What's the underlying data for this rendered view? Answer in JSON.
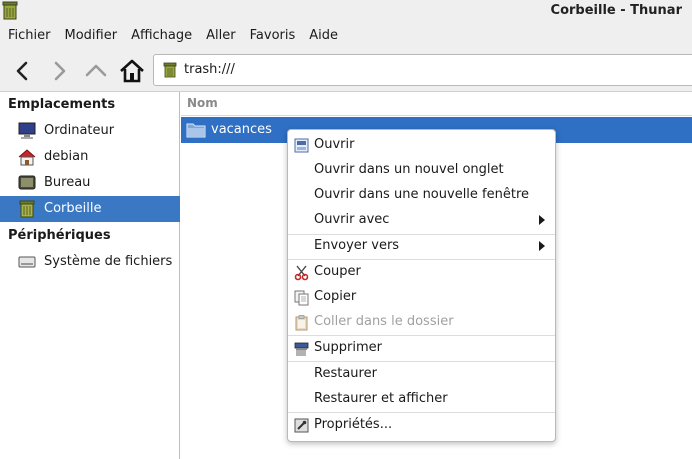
{
  "window": {
    "title": "Corbeille - Thunar"
  },
  "menubar": {
    "items": [
      "Fichier",
      "Modifier",
      "Affichage",
      "Aller",
      "Favoris",
      "Aide"
    ]
  },
  "toolbar": {
    "back_icon": "arrow-left-icon",
    "forward_icon": "arrow-right-icon",
    "up_icon": "arrow-up-icon",
    "home_icon": "home-icon",
    "location": "trash:///"
  },
  "sidebar": {
    "sections": [
      {
        "header": "Emplacements",
        "items": [
          {
            "label": "Ordinateur",
            "icon": "computer-icon"
          },
          {
            "label": "debian",
            "icon": "home-folder-icon"
          },
          {
            "label": "Bureau",
            "icon": "desktop-icon"
          },
          {
            "label": "Corbeille",
            "icon": "trash-icon",
            "selected": true
          }
        ]
      },
      {
        "header": "Périphériques",
        "items": [
          {
            "label": "Système de fichiers",
            "icon": "drive-icon"
          }
        ]
      }
    ]
  },
  "main": {
    "column_header": "Nom",
    "files": [
      {
        "name": "vacances",
        "icon": "folder-icon",
        "selected": true
      }
    ]
  },
  "context_menu": {
    "items": [
      {
        "label": "Ouvrir",
        "icon": "open-icon"
      },
      {
        "label": "Ouvrir dans un nouvel onglet"
      },
      {
        "label": "Ouvrir dans une nouvelle fenêtre"
      },
      {
        "label": "Ouvrir avec",
        "submenu": true
      },
      {
        "label": "Envoyer vers",
        "submenu": true
      },
      {
        "label": "Couper",
        "icon": "scissors-icon"
      },
      {
        "label": "Copier",
        "icon": "copy-icon"
      },
      {
        "label": "Coller dans le dossier",
        "icon": "paste-icon",
        "disabled": true
      },
      {
        "label": "Supprimer",
        "icon": "shredder-icon"
      },
      {
        "label": "Restaurer"
      },
      {
        "label": "Restaurer et afficher"
      },
      {
        "label": "Propriétés...",
        "icon": "properties-icon"
      }
    ]
  },
  "colors": {
    "selection": "#3a78c4",
    "chrome_background": "#efefef"
  }
}
